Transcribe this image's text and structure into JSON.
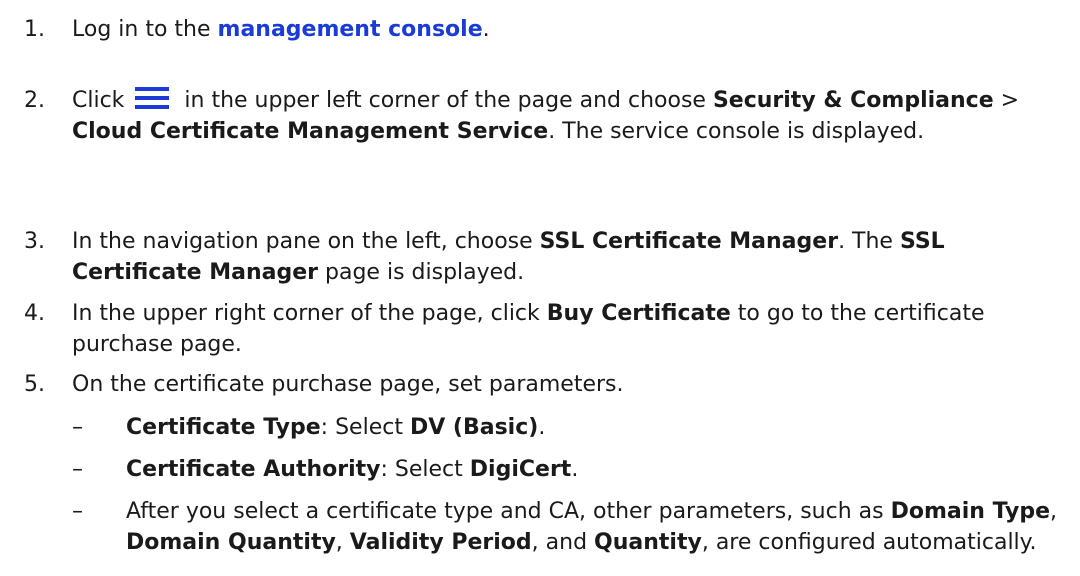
{
  "steps": [
    {
      "number": "1.",
      "parts": [
        {
          "t": "Log in to the ",
          "s": "normal"
        },
        {
          "t": "management console",
          "s": "link"
        },
        {
          "t": ".",
          "s": "normal"
        }
      ]
    },
    {
      "number": "2.",
      "parts": [
        {
          "t": "Click ",
          "s": "normal"
        },
        {
          "t": "",
          "s": "icon",
          "icon": "menu-icon"
        },
        {
          "t": " in the upper left corner of the page and choose ",
          "s": "normal"
        },
        {
          "t": "Security & Compliance",
          "s": "bold"
        },
        {
          "t": " > ",
          "s": "normal"
        },
        {
          "t": "Cloud Certificate Management Service",
          "s": "bold"
        },
        {
          "t": ". The service console is displayed.",
          "s": "normal"
        }
      ]
    },
    {
      "number": "3.",
      "parts": [
        {
          "t": "In the navigation pane on the left, choose ",
          "s": "normal"
        },
        {
          "t": "SSL Certificate Manager",
          "s": "bold"
        },
        {
          "t": ". The ",
          "s": "normal"
        },
        {
          "t": "SSL Certificate Manager",
          "s": "bold"
        },
        {
          "t": " page is displayed.",
          "s": "normal"
        }
      ]
    },
    {
      "number": "4.",
      "parts": [
        {
          "t": "In the upper right corner of the page, click ",
          "s": "normal"
        },
        {
          "t": "Buy Certificate",
          "s": "bold"
        },
        {
          "t": " to go to the certificate purchase page.",
          "s": "normal"
        }
      ]
    },
    {
      "number": "5.",
      "parts": [
        {
          "t": "On the certificate purchase page, set parameters.",
          "s": "normal"
        }
      ]
    }
  ],
  "sub_items": [
    {
      "bullet": "–",
      "parts": [
        {
          "t": "Certificate Type",
          "s": "bold"
        },
        {
          "t": ": Select ",
          "s": "normal"
        },
        {
          "t": "DV (Basic)",
          "s": "bold"
        },
        {
          "t": ".",
          "s": "normal"
        }
      ]
    },
    {
      "bullet": "–",
      "parts": [
        {
          "t": "Certificate Authority",
          "s": "bold"
        },
        {
          "t": ": Select ",
          "s": "normal"
        },
        {
          "t": "DigiCert",
          "s": "bold"
        },
        {
          "t": ".",
          "s": "normal"
        }
      ]
    },
    {
      "bullet": "–",
      "parts": [
        {
          "t": "After you select a certificate type and CA, other parameters, such as ",
          "s": "normal"
        },
        {
          "t": "Domain Type",
          "s": "bold"
        },
        {
          "t": ", ",
          "s": "normal"
        },
        {
          "t": "Domain Quantity",
          "s": "bold"
        },
        {
          "t": ", ",
          "s": "normal"
        },
        {
          "t": "Validity Period",
          "s": "bold"
        },
        {
          "t": ", and ",
          "s": "normal"
        },
        {
          "t": "Quantity",
          "s": "bold"
        },
        {
          "t": ", are configured automatically.",
          "s": "normal"
        }
      ]
    }
  ],
  "colors": {
    "link": "#1a3bd6",
    "text": "#1a1a1a"
  }
}
